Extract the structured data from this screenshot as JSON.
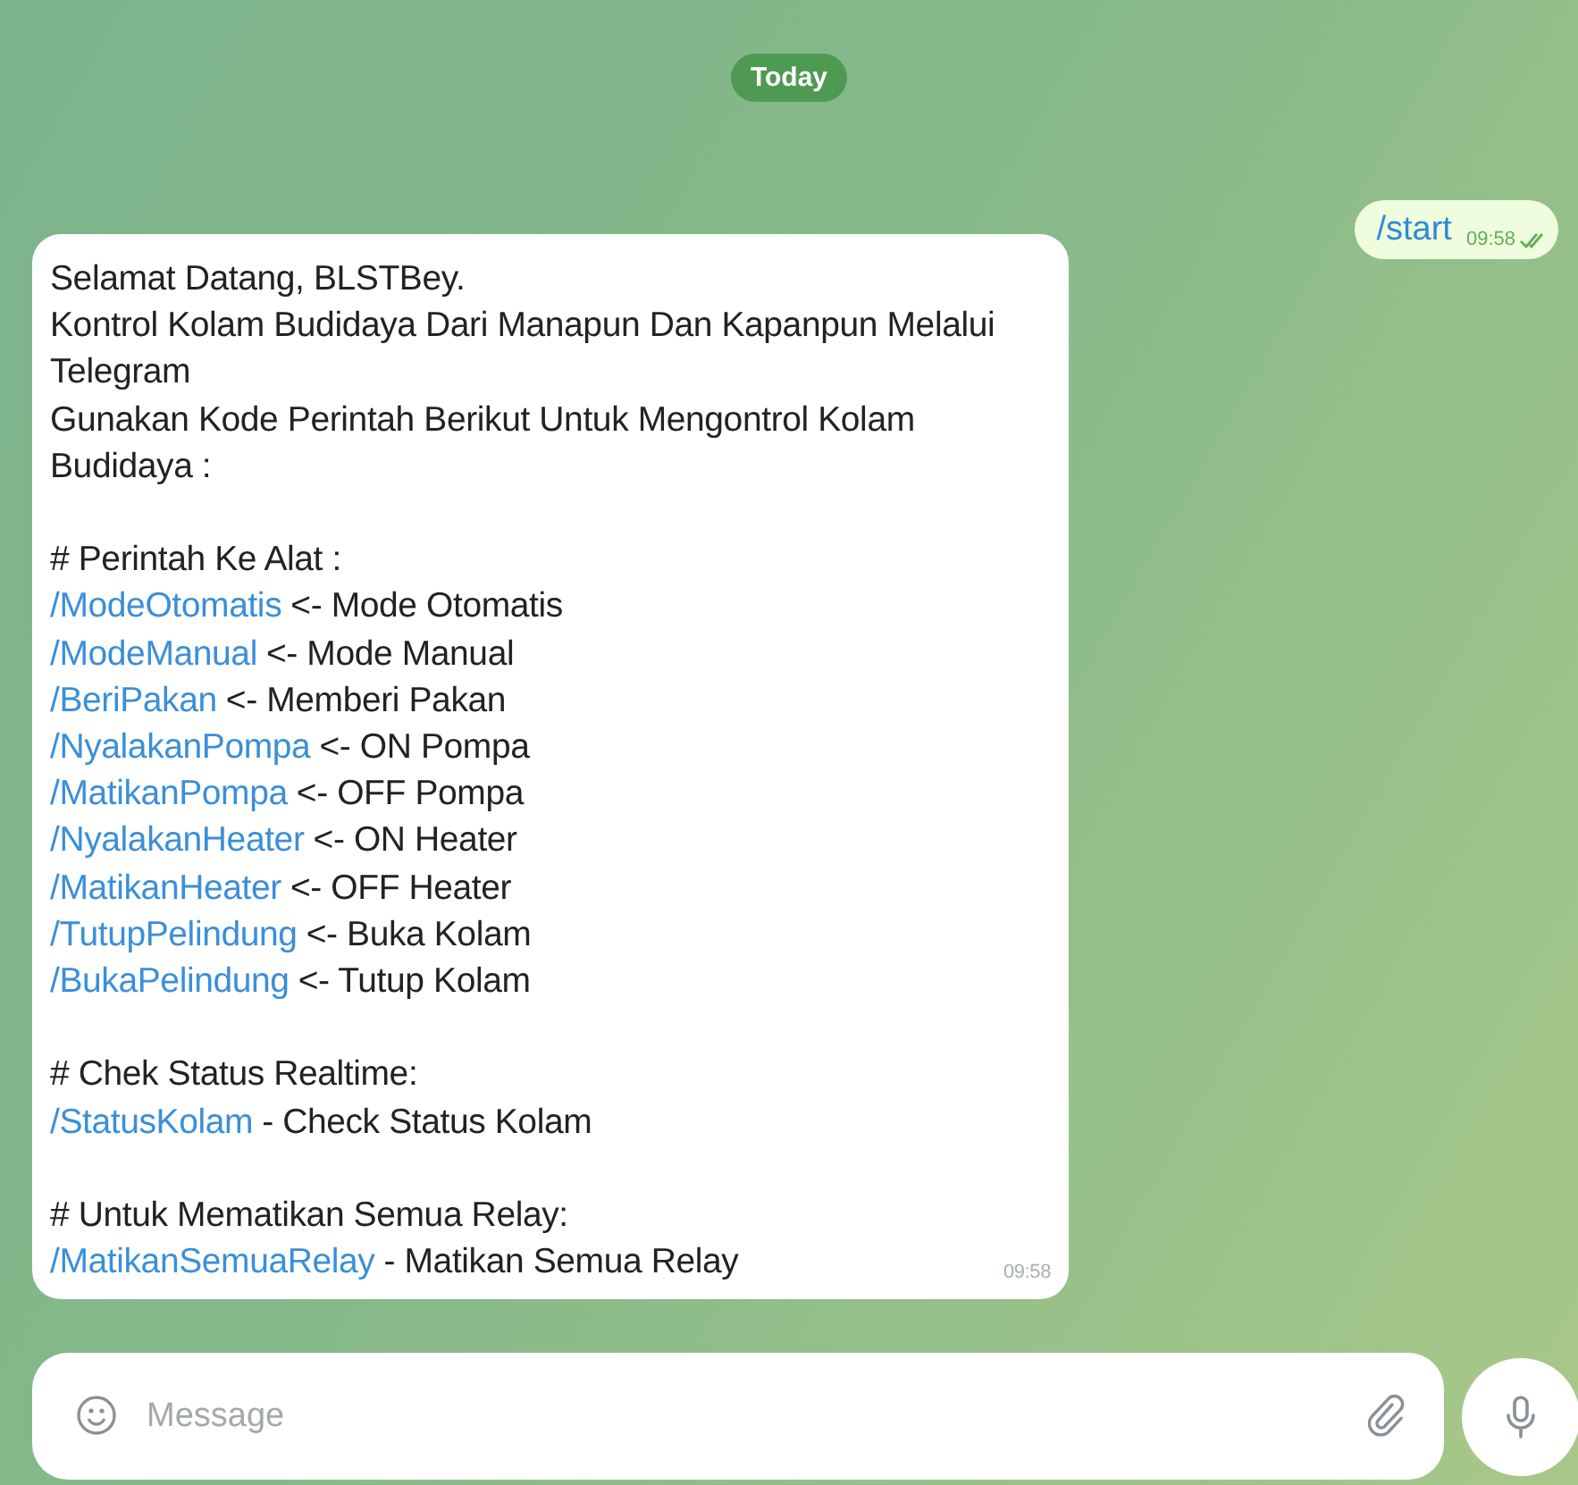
{
  "date_badge": "Today",
  "outgoing": {
    "text": "/start",
    "time": "09:58",
    "read": true
  },
  "incoming": {
    "time": "09:58",
    "sections": [
      {
        "items": [
          {
            "kind": "text",
            "text": "Selamat Datang, BLSTBey."
          },
          {
            "kind": "text",
            "text": "Kontrol Kolam Budidaya Dari Manapun Dan Kapanpun Melalui Telegram"
          },
          {
            "kind": "text",
            "text": "Gunakan Kode Perintah Berikut Untuk Mengontrol Kolam Budidaya :"
          }
        ]
      },
      {
        "items": [
          {
            "kind": "text",
            "text": "# Perintah Ke Alat :"
          },
          {
            "kind": "command",
            "command": "/ModeOtomatis",
            "description": "<- Mode Otomatis"
          },
          {
            "kind": "command",
            "command": "/ModeManual",
            "description": "<- Mode Manual"
          },
          {
            "kind": "command",
            "command": "/BeriPakan",
            "description": "<- Memberi Pakan"
          },
          {
            "kind": "command",
            "command": "/NyalakanPompa",
            "description": "<- ON Pompa"
          },
          {
            "kind": "command",
            "command": "/MatikanPompa",
            "description": "<- OFF Pompa"
          },
          {
            "kind": "command",
            "command": "/NyalakanHeater",
            "description": "<- ON Heater"
          },
          {
            "kind": "command",
            "command": "/MatikanHeater",
            "description": "<- OFF Heater"
          },
          {
            "kind": "command",
            "command": "/TutupPelindung",
            "description": "<- Buka Kolam"
          },
          {
            "kind": "command",
            "command": "/BukaPelindung",
            "description": "<- Tutup Kolam"
          }
        ]
      },
      {
        "items": [
          {
            "kind": "text",
            "text": "# Chek Status Realtime:"
          },
          {
            "kind": "command",
            "command": "/StatusKolam",
            "description": "- Check Status Kolam"
          }
        ]
      },
      {
        "items": [
          {
            "kind": "text",
            "text": "# Untuk Mematikan Semua Relay:"
          },
          {
            "kind": "command",
            "command": "/MatikanSemuaRelay",
            "description": "- Matikan Semua Relay"
          }
        ]
      }
    ]
  },
  "composer": {
    "placeholder": "Message"
  }
}
